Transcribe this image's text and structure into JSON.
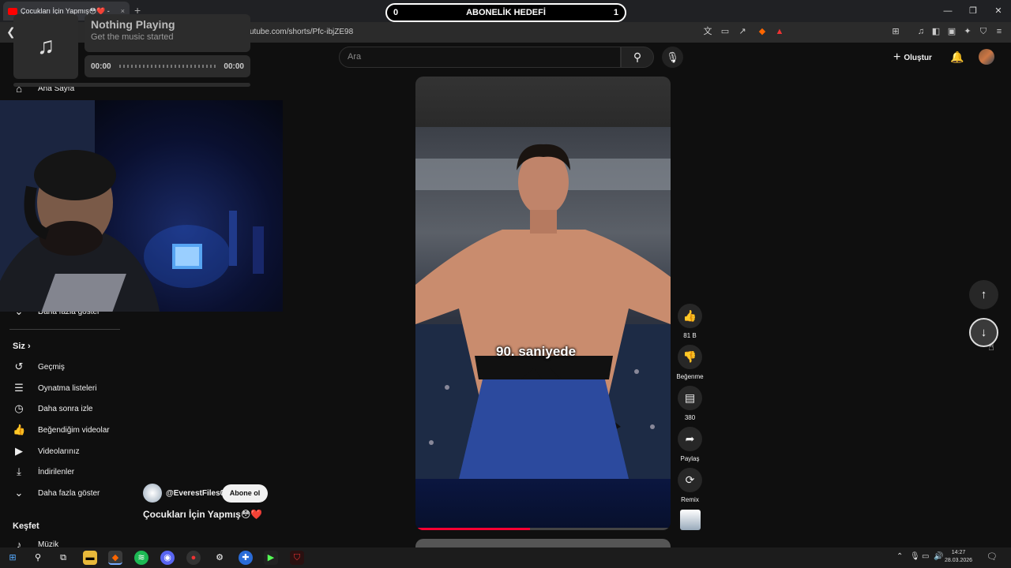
{
  "browser": {
    "tab_title": "Çocukları İçin Yapmış😳❤️ -",
    "tab_close": "×",
    "new_tab": "+",
    "url": "utube.com/shorts/Pfc-ibjZE98",
    "window_controls": [
      "—",
      "❐",
      "✕"
    ]
  },
  "overlay": {
    "goal_label": "ABONELİK HEDEFİ",
    "goal_current": "0",
    "goal_target": "1"
  },
  "music_widget": {
    "title": "Nothing Playing",
    "subtitle": "Get the music started",
    "time_start": "00:00",
    "time_end": "00:00"
  },
  "youtube": {
    "search_placeholder": "Ara",
    "create_label": "Oluştur"
  },
  "sidebar": {
    "home": "Ana Sayfa",
    "show_more_top": "Daha fazla göster",
    "you_heading": "Siz",
    "items": [
      {
        "label": "Geçmiş",
        "icon": "history-icon"
      },
      {
        "label": "Oynatma listeleri",
        "icon": "playlist-icon"
      },
      {
        "label": "Daha sonra izle",
        "icon": "clock-icon"
      },
      {
        "label": "Beğendiğim videolar",
        "icon": "thumb-up-icon"
      },
      {
        "label": "Videolarınız",
        "icon": "video-icon"
      },
      {
        "label": "İndirilenler",
        "icon": "download-icon"
      },
      {
        "label": "Daha fazla göster",
        "icon": "chevron-down-icon"
      }
    ],
    "explore_heading": "Keşfet",
    "music": "Müzik"
  },
  "short": {
    "caption": "90. saniyede",
    "channel": "@EverestFiles0",
    "subscribe": "Abone ol",
    "title": "Çocukları İçin Yapmış😳❤️",
    "progress_fraction": 0.45
  },
  "actions": {
    "likes": "81 B",
    "dislike": "Beğenme",
    "comments": "380",
    "share": "Paylaş",
    "remix": "Remix"
  },
  "taskbar": {
    "time": "14:27",
    "date": "28.03.2026"
  }
}
